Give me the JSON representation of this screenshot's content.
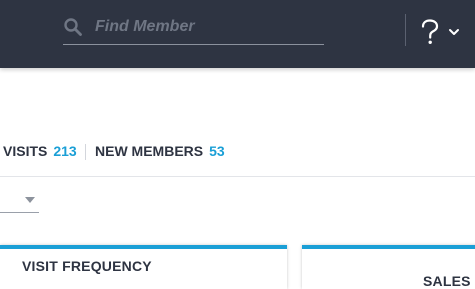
{
  "header": {
    "search": {
      "placeholder": "Find Member",
      "value": ""
    },
    "icons": {
      "search": "search-icon",
      "help": "help-question-icon",
      "menu_toggle": "chevron-down-icon"
    },
    "colors": {
      "background": "#2e3442",
      "icon": "#ffffff",
      "muted": "#6f7684"
    }
  },
  "stats": [
    {
      "label": "VISITS",
      "value": "213"
    },
    {
      "label": "NEW MEMBERS",
      "value": "53"
    }
  ],
  "filter": {
    "selected": ""
  },
  "cards": [
    {
      "title": "VISIT FREQUENCY"
    },
    {
      "title": "SALES I"
    }
  ],
  "colors": {
    "accent": "#1a9fd6",
    "text": "#2e3442"
  }
}
